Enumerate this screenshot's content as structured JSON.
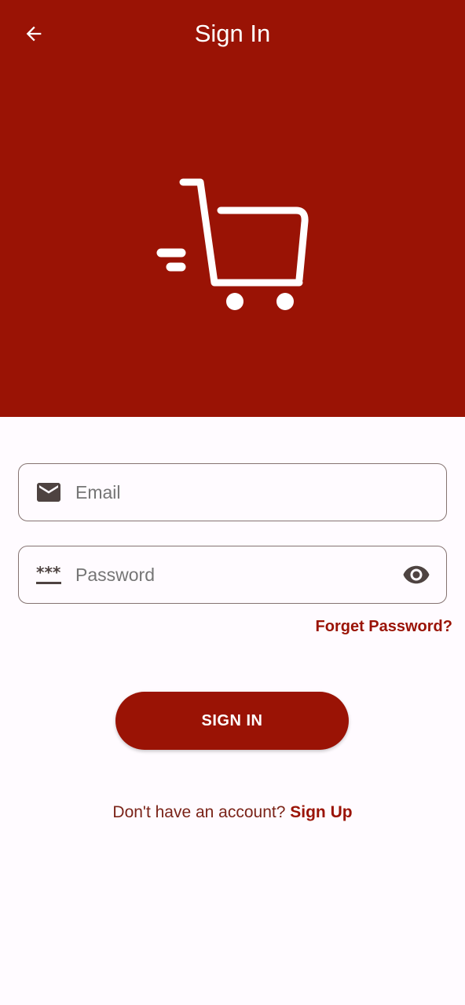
{
  "header": {
    "title": "Sign In",
    "back_icon": "arrow-back-icon"
  },
  "hero": {
    "logo_icon": "shopping-cart-icon",
    "background_color": "#9a1305"
  },
  "form": {
    "email": {
      "placeholder": "Email",
      "value": "",
      "icon": "mail-icon"
    },
    "password": {
      "placeholder": "Password",
      "value": "",
      "icon": "password-icon",
      "toggle_icon": "eye-icon"
    },
    "forgot_label": "Forget Password?",
    "submit_label": "SIGN IN"
  },
  "footer": {
    "prompt": "Don't have an account?",
    "link_label": "Sign Up"
  },
  "colors": {
    "primary": "#9a1305",
    "background": "#fffbff",
    "outline": "#857371",
    "on_surface_variant": "#5c5352"
  }
}
